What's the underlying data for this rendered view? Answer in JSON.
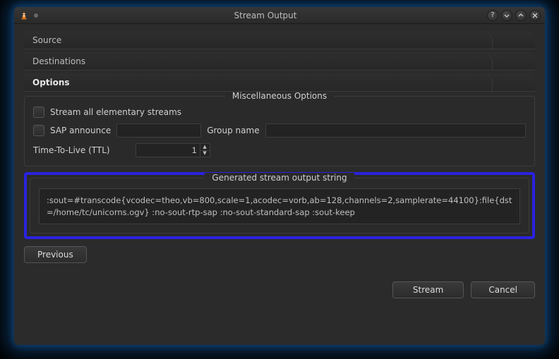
{
  "window": {
    "title": "Stream Output"
  },
  "tabs": {
    "source": "Source",
    "destinations": "Destinations",
    "options": "Options"
  },
  "misc": {
    "legend": "Miscellaneous Options",
    "stream_all_label": "Stream all elementary streams",
    "sap_label": "SAP announce",
    "sap_value": "",
    "group_label": "Group name",
    "group_value": "",
    "ttl_label": "Time-To-Live (TTL)",
    "ttl_value": "1"
  },
  "generated": {
    "legend": "Generated stream output string",
    "value": ":sout=#transcode{vcodec=theo,vb=800,scale=1,acodec=vorb,ab=128,channels=2,samplerate=44100}:file{dst=/home/tc/unicorns.ogv} :no-sout-rtp-sap :no-sout-standard-sap :sout-keep"
  },
  "buttons": {
    "previous": "Previous",
    "stream": "Stream",
    "cancel": "Cancel"
  }
}
